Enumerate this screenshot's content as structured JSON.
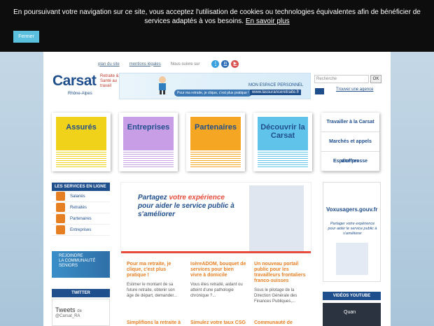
{
  "cookie": {
    "text": "En poursuivant votre navigation sur ce site, vous acceptez l'utilisation de cookies ou technologies équivalentes afin de bénéficier de services adaptés à vos besoins.",
    "more": "En savoir plus",
    "close": "Fermer"
  },
  "util": {
    "plan": "plan du site",
    "mentions": "mentions légales",
    "follow": "Nous suivre sur"
  },
  "logo": {
    "brand": "Carsat",
    "tagline": "Retraite & Santé au travail",
    "region": "Rhône-Alpes"
  },
  "banner": {
    "pill": "Pour ma retraite, je clique, c'est plus pratique !",
    "space": "MON ESPACE PERSONNEL",
    "url": "www.lassuranceretraite.fr"
  },
  "search": {
    "placeholder": "Recherche",
    "ok": "OK",
    "agence": "Trouver une agence"
  },
  "tiles": [
    {
      "label": "Assurés",
      "color": "#f1d21b"
    },
    {
      "label": "Entreprises",
      "color": "#c89ee6"
    },
    {
      "label": "Partenaires",
      "color": "#f5a623"
    },
    {
      "label": "Découvrir la Carsat",
      "color": "#60c4ea"
    }
  ],
  "side": [
    "Travailler à la Carsat",
    "Marchés et appels d'offres",
    "Espace presse"
  ],
  "services": {
    "title": "LES SERVICES EN LIGNE",
    "items": [
      "Salariés",
      "Retraités",
      "Partenaires",
      "Entreprises"
    ]
  },
  "rejoin": {
    "l1": "REJOINDRE",
    "l2": "LA COMMUNAUTÉ",
    "l3": "SENIORS"
  },
  "twitter": {
    "title": "TWITTER",
    "tweets": "Tweets",
    "by": "de",
    "handle": "@Carsat_RA"
  },
  "hero": {
    "a": "Partagez ",
    "b": "votre expérience",
    "c": "pour aider le service public à s'améliorer"
  },
  "news": [
    {
      "t": "Pour ma retraite, je clique, c'est plus pratique !",
      "d": "Estimer le montant de sa future retraite, obtenir son âge de départ, demander..."
    },
    {
      "t": "IsèreADOM, bouquet de services pour bien vivre à domicile",
      "d": "Vous êtes retraité, aidant ou atteint d'une pathologie chronique ?..."
    },
    {
      "t": "Un nouveau portail public pour les travailleurs frontaliers franco-suisses",
      "d": "Sous le pilotage de la Direction Générale des Finances Publiques,..."
    }
  ],
  "news2": [
    "Simplifions la retraite à",
    "Simulez votre taux CSG",
    "Communauté de"
  ],
  "vox": {
    "brand": "Voxusagers.gouv.fr",
    "p": "Partager votre expérience pour aider le service public à s'améliorer"
  },
  "video": {
    "title": "VIDÉOS YOUTUBE",
    "label": "Quan"
  }
}
